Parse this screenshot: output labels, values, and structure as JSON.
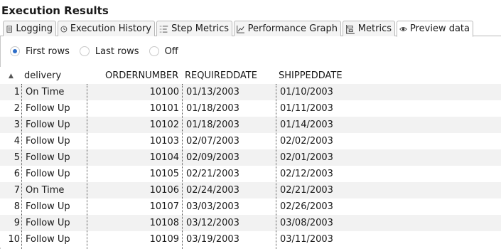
{
  "title": "Execution Results",
  "tabs": [
    {
      "label": "Logging",
      "icon": "log-document-icon"
    },
    {
      "label": "Execution History",
      "icon": "history-clock-icon"
    },
    {
      "label": "Step Metrics",
      "icon": "step-metrics-icon"
    },
    {
      "label": "Performance Graph",
      "icon": "performance-graph-icon"
    },
    {
      "label": "Metrics",
      "icon": "metrics-icon"
    },
    {
      "label": "Preview data",
      "icon": "eye-icon",
      "active": true
    }
  ],
  "preview_options": {
    "selected": "First rows",
    "options": [
      "First rows",
      "Last rows",
      "Off"
    ]
  },
  "table": {
    "sort_indicator": "▲",
    "columns": [
      "delivery",
      "ORDERNUMBER",
      "REQUIREDDATE",
      "SHIPPEDDATE"
    ],
    "rows": [
      {
        "idx": "1",
        "delivery": "On Time",
        "order": "10100",
        "required": "01/13/2003",
        "shipped": "01/10/2003"
      },
      {
        "idx": "2",
        "delivery": "Follow Up",
        "order": "10101",
        "required": "01/18/2003",
        "shipped": "01/11/2003"
      },
      {
        "idx": "3",
        "delivery": "Follow Up",
        "order": "10102",
        "required": "01/18/2003",
        "shipped": "01/14/2003"
      },
      {
        "idx": "4",
        "delivery": "Follow Up",
        "order": "10103",
        "required": "02/07/2003",
        "shipped": "02/02/2003"
      },
      {
        "idx": "5",
        "delivery": "Follow Up",
        "order": "10104",
        "required": "02/09/2003",
        "shipped": "02/01/2003"
      },
      {
        "idx": "6",
        "delivery": "Follow Up",
        "order": "10105",
        "required": "02/21/2003",
        "shipped": "02/12/2003"
      },
      {
        "idx": "7",
        "delivery": "On Time",
        "order": "10106",
        "required": "02/24/2003",
        "shipped": "02/21/2003"
      },
      {
        "idx": "8",
        "delivery": "Follow Up",
        "order": "10107",
        "required": "03/03/2003",
        "shipped": "02/26/2003"
      },
      {
        "idx": "9",
        "delivery": "Follow Up",
        "order": "10108",
        "required": "03/12/2003",
        "shipped": "03/08/2003"
      },
      {
        "idx": "10",
        "delivery": "Follow Up",
        "order": "10109",
        "required": "03/19/2003",
        "shipped": "03/11/2003"
      }
    ]
  },
  "colors": {
    "radio_selected": "#2d6ec8",
    "stripe": "#f2f2f2",
    "border": "#b9b9b9"
  }
}
